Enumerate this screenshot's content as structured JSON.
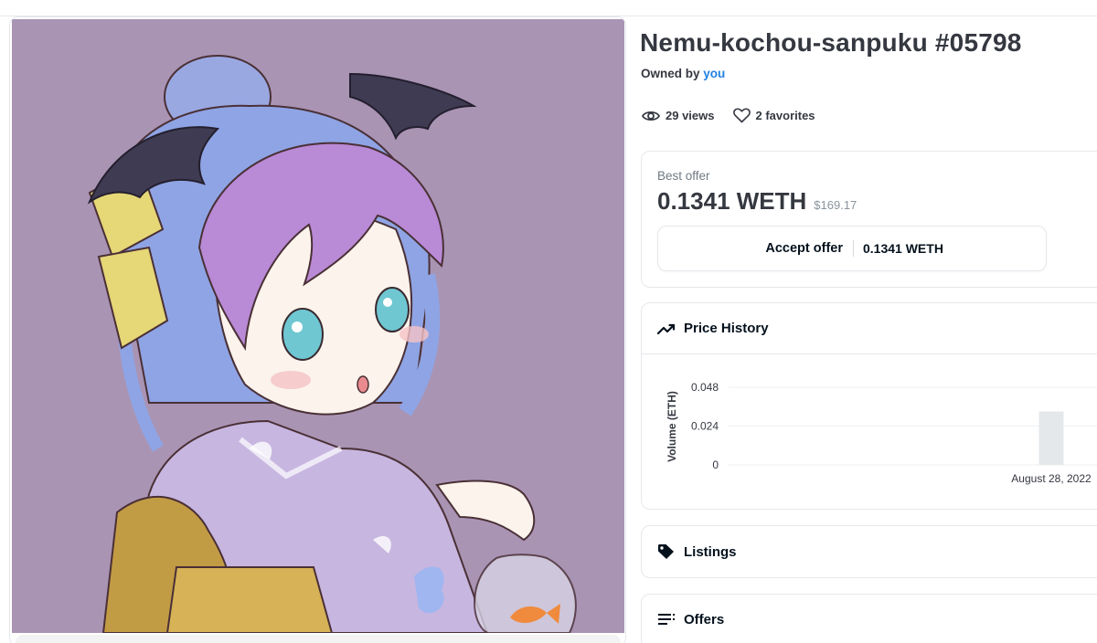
{
  "nft": {
    "title": "Nemu-kochou-sanpuku #05798",
    "owned_by_label": "Owned by",
    "owner": "you",
    "views": "29 views",
    "favorites": "2 favorites"
  },
  "offer": {
    "best_offer_label": "Best offer",
    "price": "0.1341 WETH",
    "usd": "$169.17",
    "accept_label": "Accept offer",
    "accept_price": "0.1341 WETH"
  },
  "price_history": {
    "label": "Price History",
    "chart_data": {
      "type": "bar",
      "ylabel": "Volume (ETH)",
      "yticks": [
        "0.048",
        "0.024",
        "0"
      ],
      "ylim": [
        0,
        0.048
      ],
      "categories": [
        "August 28, 2022"
      ],
      "values": [
        0.033
      ],
      "bar_color": "#e5e8eb"
    }
  },
  "listings": {
    "label": "Listings"
  },
  "offers": {
    "label": "Offers"
  },
  "colors": {
    "link": "#2081e2",
    "text": "#353840",
    "border": "#e5e8eb",
    "artwork_bg": "#a994b4"
  }
}
